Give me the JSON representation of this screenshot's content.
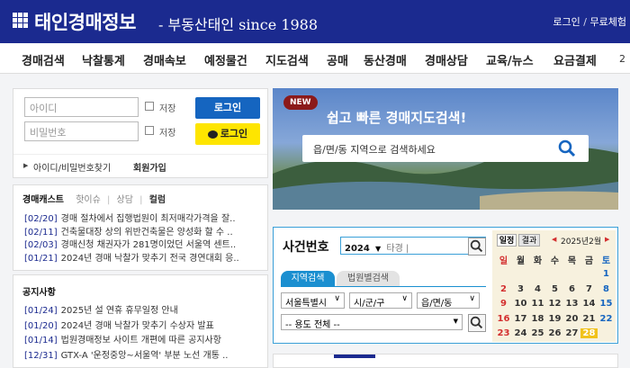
{
  "header": {
    "logo_text": "태인경매정보",
    "logo_sub": "- 부동산태인 since 1988",
    "links": [
      "로그인",
      "/",
      "무료체험"
    ]
  },
  "nav": {
    "items": [
      "경매검색",
      "낙찰통계",
      "경매속보",
      "예정물건",
      "지도검색",
      "공매",
      "동산경매",
      "경매상담",
      "교육/뉴스",
      "요금결제"
    ],
    "right_fragment": "2"
  },
  "login": {
    "id_placeholder": "아이디",
    "pw_placeholder": "비밀번호",
    "save_label": "저장",
    "login_button": "로그인",
    "kakao_button": "로그인",
    "find_link": "아이디/비밀번호찾기",
    "join_link": "회원가입"
  },
  "news": {
    "tabs": [
      "경매캐스트",
      "핫이슈",
      "상담",
      "컬럼"
    ],
    "items": [
      {
        "date": "[02/20]",
        "text": "경매 절차에서 집행법원이 최저매각가격을 잘.."
      },
      {
        "date": "[02/11]",
        "text": "건축물대장 상의 위반건축물은 양성화 할 수 .."
      },
      {
        "date": "[02/03]",
        "text": "경매신청 채권자가 281명이었던 서울역 센트.."
      },
      {
        "date": "[01/21]",
        "text": "2024년 경매 낙찰가 맞추기 전국 경연대회 응.."
      }
    ]
  },
  "notice": {
    "title": "공지사항",
    "items": [
      {
        "date": "[01/24]",
        "text": "2025년 설 연휴 휴무일정 안내"
      },
      {
        "date": "[01/20]",
        "text": "2024년 경매 낙찰가 맞추기 수상자 발표"
      },
      {
        "date": "[01/14]",
        "text": "법원경매정보 사이트 개편에 따른 공지사항"
      },
      {
        "date": "[12/31]",
        "text": "GTX-A '운정중앙~서울역' 부분 노선 개통 .."
      }
    ]
  },
  "banner": {
    "badge": "NEW",
    "title": "쉽고 빠른 경매지도검색!",
    "search_placeholder": "읍/면/동 지역으로 검색하세요"
  },
  "case_search": {
    "title": "사건번호",
    "year": "2024",
    "input_placeholder": "타경 |",
    "tabs": [
      "지역검색",
      "법원별검색"
    ],
    "selects": [
      "서울특별시",
      "시/군/구",
      "읍/면/동"
    ],
    "usage_select": "-- 용도 전체 --"
  },
  "calendar": {
    "tabs": [
      "일정",
      "결과"
    ],
    "month_label": "2025년2월",
    "weekdays": [
      "일",
      "월",
      "화",
      "수",
      "목",
      "금",
      "토"
    ],
    "weeks": [
      [
        "",
        "",
        "",
        "",
        "",
        "",
        "1"
      ],
      [
        "2",
        "3",
        "4",
        "5",
        "6",
        "7",
        "8"
      ],
      [
        "9",
        "10",
        "11",
        "12",
        "13",
        "14",
        "15"
      ],
      [
        "16",
        "17",
        "18",
        "19",
        "20",
        "21",
        "22"
      ],
      [
        "23",
        "24",
        "25",
        "26",
        "27",
        "28",
        ""
      ]
    ],
    "today": "28",
    "colors": {
      "sunday": "#d32f2f",
      "saturday": "#1565c0",
      "today_bg": "#f1c21b"
    }
  },
  "colors": {
    "brand": "#1b2a8f",
    "login_blue": "#1565c0",
    "kakao": "#fee500"
  }
}
